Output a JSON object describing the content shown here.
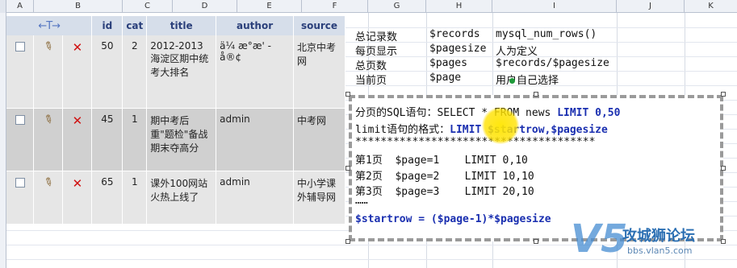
{
  "spreadsheet": {
    "columns": [
      "A",
      "B",
      "C",
      "D",
      "E",
      "F",
      "G",
      "H",
      "I",
      "J",
      "K"
    ]
  },
  "db_table": {
    "arrow_header": "←T→",
    "headers": [
      "id",
      "cat",
      "title",
      "author",
      "source"
    ],
    "rows": [
      {
        "id": "50",
        "cat": "2",
        "title": "2012-2013海淀区期中统考大排名",
        "author": "ä¼ æ°æ' - å®¢",
        "source": "北京中考网"
      },
      {
        "id": "45",
        "cat": "1",
        "title": "期中考后重\"题检\"备战期末夺高分",
        "author": "admin",
        "source": "中考网"
      },
      {
        "id": "65",
        "cat": "1",
        "title": "课外100网站火热上线了",
        "author": "admin",
        "source": "中小学课外辅导网"
      }
    ]
  },
  "info": {
    "rows": [
      {
        "label": "总记录数",
        "var": "$records",
        "desc": "mysql_num_rows()"
      },
      {
        "label": "每页显示",
        "var": "$pagesize",
        "desc": "人为定义"
      },
      {
        "label": "总页数",
        "var": "$pages",
        "desc": "$records/$pagesize"
      },
      {
        "label": "当前页",
        "var": "$page",
        "desc": "用户自己选择"
      }
    ]
  },
  "note": {
    "line1_prefix": "分页的SQL语句：SELECT * FROM news ",
    "line1_kw": "LIMIT 0,50",
    "line2_prefix": "limit语句的格式：",
    "line2_kw": "LIMIT $startrow,$pagesize",
    "line3": "**************************************",
    "page_rows": [
      {
        "page": "第1页",
        "var": "$page=1",
        "limit": "LIMIT 0,10"
      },
      {
        "page": "第2页",
        "var": "$page=2",
        "limit": "LIMIT 10,10"
      },
      {
        "page": "第3页",
        "var": "$page=3",
        "limit": "LIMIT 20,10"
      }
    ],
    "ellipsis": "……",
    "formula": "$startrow = ($page-1)*$pagesize"
  },
  "watermark": {
    "logo": "V5",
    "name": "攻城狮论坛",
    "url": "bbs.vlan5.com"
  }
}
